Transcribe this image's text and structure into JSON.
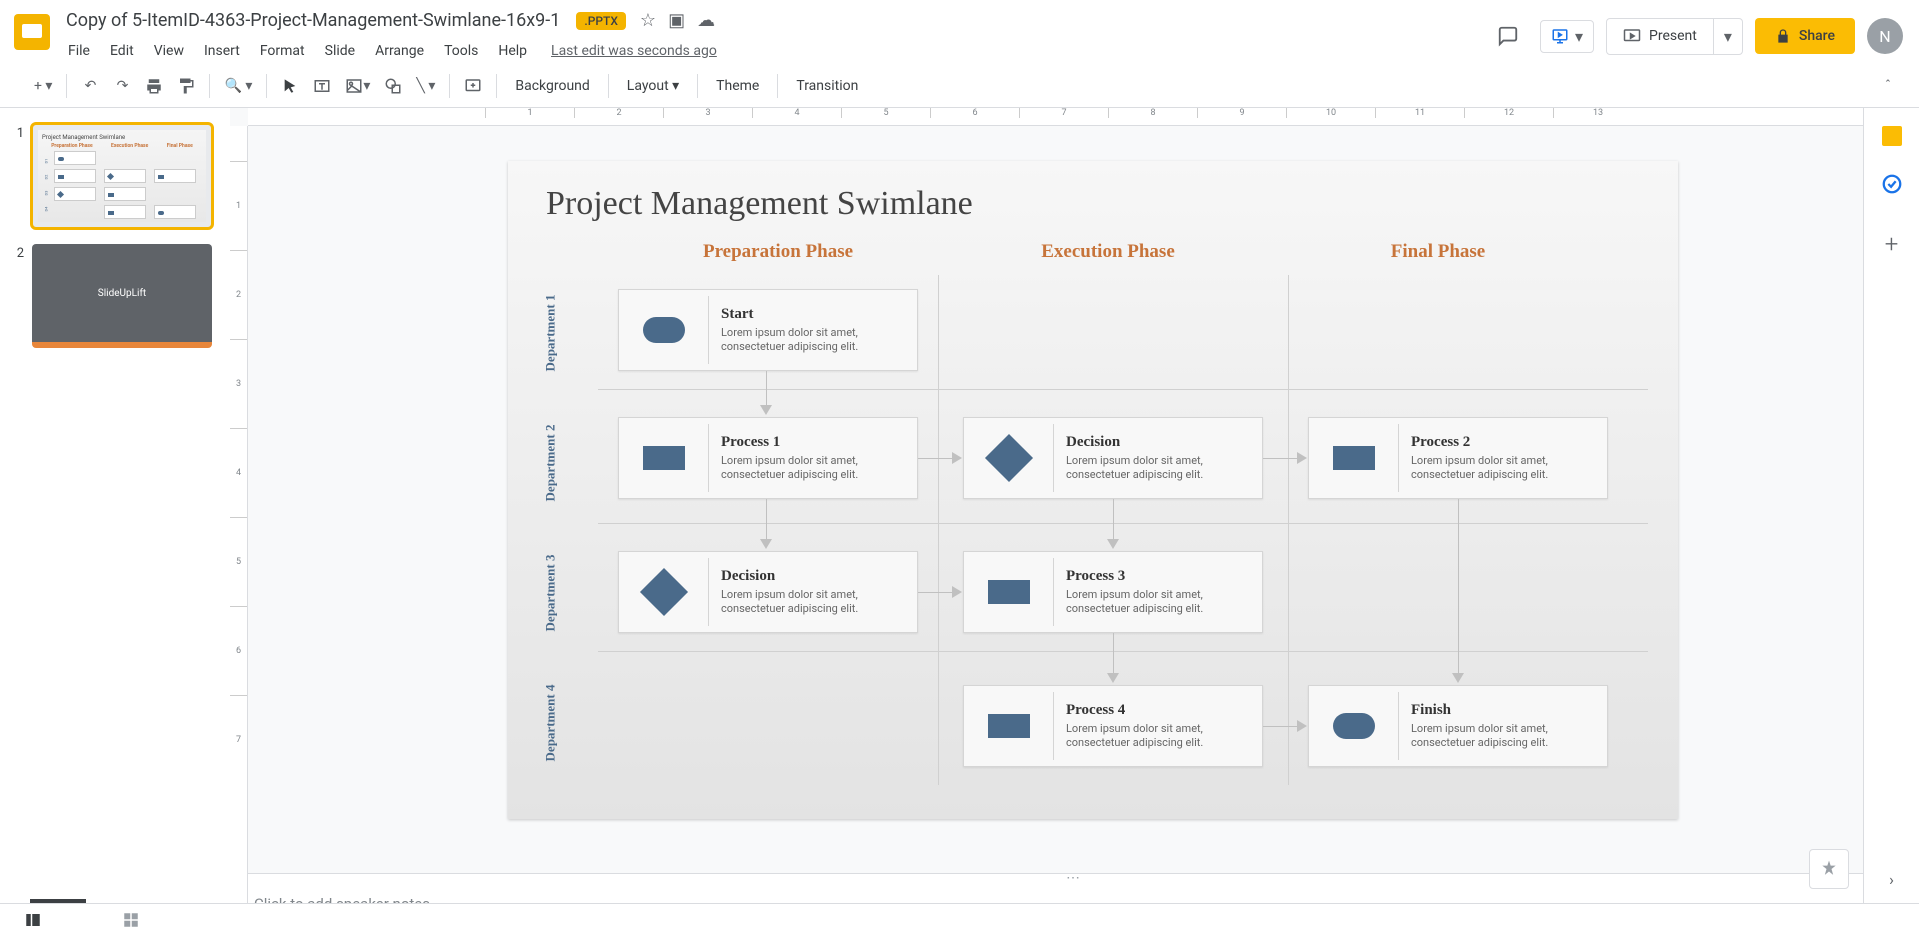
{
  "header": {
    "doc_title": "Copy of 5-ItemID-4363-Project-Management-Swimlane-16x9-1",
    "badge": ".PPTX",
    "last_edit": "Last edit was seconds ago",
    "present": "Present",
    "share": "Share",
    "avatar_initial": "N"
  },
  "menubar": [
    "File",
    "Edit",
    "View",
    "Insert",
    "Format",
    "Slide",
    "Arrange",
    "Tools",
    "Help"
  ],
  "toolbar": {
    "background": "Background",
    "layout": "Layout",
    "theme": "Theme",
    "transition": "Transition"
  },
  "thumbnails": {
    "slide1_num": "1",
    "slide2_num": "2",
    "slide2_text": "SlideUpLift"
  },
  "ruler_h": [
    "1",
    "2",
    "3",
    "4",
    "5",
    "6",
    "7",
    "8",
    "9",
    "10",
    "11",
    "12",
    "13"
  ],
  "ruler_v": [
    "1",
    "2",
    "3",
    "4",
    "5",
    "6",
    "7"
  ],
  "slide": {
    "title": "Project Management Swimlane",
    "phases": [
      "Preparation Phase",
      "Execution Phase",
      "Final Phase"
    ],
    "departments": [
      "Department 1",
      "Department 2",
      "Department 3",
      "Department 4"
    ],
    "lorem": "Lorem ipsum dolor sit amet, consectetuer adipiscing elit.",
    "cards": {
      "start": "Start",
      "process1": "Process 1",
      "decision1": "Decision",
      "process2": "Process 2",
      "decision2": "Decision",
      "process3": "Process 3",
      "process4": "Process 4",
      "finish": "Finish"
    }
  },
  "speaker_notes_placeholder": "Click to add speaker notes"
}
